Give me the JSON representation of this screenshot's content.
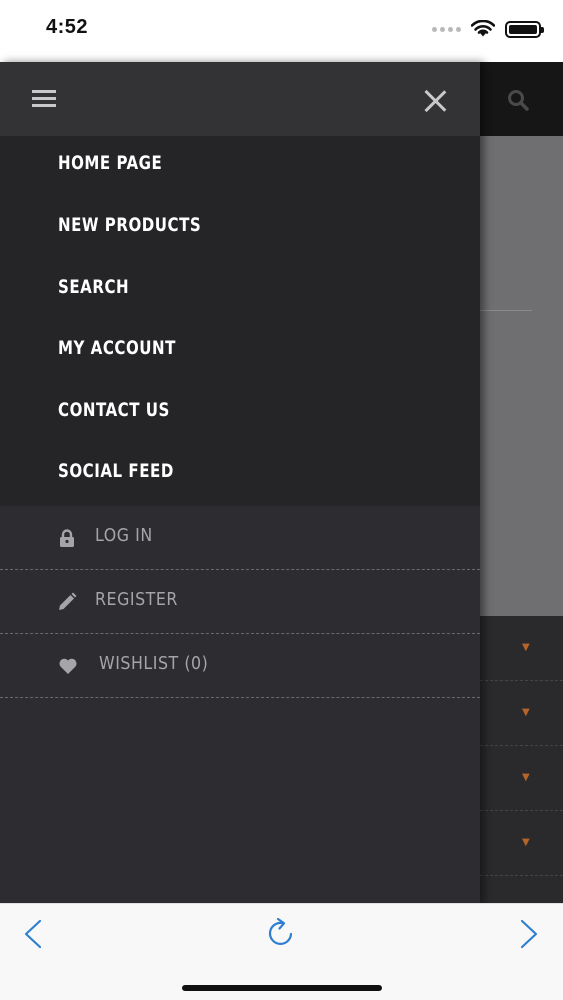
{
  "status_bar": {
    "time": "4:52"
  },
  "drawer": {
    "menu": [
      {
        "label": "HOME PAGE"
      },
      {
        "label": "NEW PRODUCTS"
      },
      {
        "label": "SEARCH"
      },
      {
        "label": "MY ACCOUNT"
      },
      {
        "label": "CONTACT US"
      },
      {
        "label": "SOCIAL FEED"
      }
    ],
    "user_links": [
      {
        "label": "LOG IN",
        "icon": "lock-icon"
      },
      {
        "label": "REGISTER",
        "icon": "pencil-icon"
      },
      {
        "label": "WISHLIST (0)",
        "icon": "heart-icon"
      }
    ]
  },
  "colors": {
    "drawer_bg": "#2d2c30",
    "menu_bg": "#252427",
    "menu_text": "#ffffff",
    "secondary_text": "#a5a5a7",
    "toolbar_accent": "#2f7fd0"
  }
}
